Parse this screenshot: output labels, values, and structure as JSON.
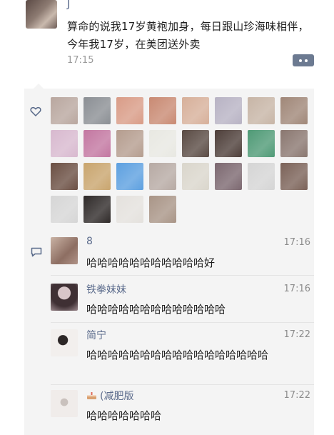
{
  "post": {
    "poster_name": "J",
    "text": "算命的说我17岁黄袍加身，每日跟山珍海味相伴，今年我17岁，在美团送外卖",
    "time": "17:15"
  },
  "likes": {
    "avatars": [
      {
        "color": "#b9a79f"
      },
      {
        "color": "#8b8f94"
      },
      {
        "color": "#d99c87"
      },
      {
        "color": "#c98a73"
      },
      {
        "color": "#d7b09a"
      },
      {
        "color": "#b8b3c4"
      },
      {
        "color": "#c7b5a6"
      },
      {
        "color": "#a08778"
      },
      {
        "color": "#d8b9cf"
      },
      {
        "color": "#c377a1"
      },
      {
        "color": "#b59d8f"
      },
      {
        "color": "#e8e8e2"
      },
      {
        "color": "#5a4b44"
      },
      {
        "color": "#4e3f3a"
      },
      {
        "color": "#4f9a76"
      },
      {
        "color": "#8a7770"
      },
      {
        "color": "#6b4f43"
      },
      {
        "color": "#c9a56e"
      },
      {
        "color": "#5da0e0"
      },
      {
        "color": "#b7aaa4"
      },
      {
        "color": "#dad6cc"
      },
      {
        "color": "#7c6870"
      },
      {
        "color": "#d5d5d5"
      },
      {
        "color": "#7b6258"
      },
      {
        "color": "#d6d6d6"
      },
      {
        "color": "#2f2a29"
      },
      {
        "color": "#e4e1dd"
      },
      {
        "color": "#a99587"
      }
    ]
  },
  "comments": [
    {
      "name": "8",
      "time": "17:16",
      "text": "哈哈哈哈哈哈哈哈哈哈哈好",
      "avatar_color": "#a58a7d"
    },
    {
      "name": "铁拳妹妹",
      "time": "17:16",
      "text": "哈哈哈哈哈哈哈哈哈哈哈哈哈",
      "avatar_color": "#6d5a63"
    },
    {
      "name": "简宁",
      "time": "17:22",
      "text": "哈哈哈哈哈哈哈哈哈哈哈哈哈哈哈哈哈",
      "avatar_color": "#e9e6e4"
    },
    {
      "name": "(减肥版",
      "time": "17:22",
      "text": "哈哈哈哈哈哈哈",
      "avatar_color": "#e6e2e0"
    }
  ],
  "colors": {
    "link_name": "#5b6b8c",
    "panel_bg": "#f4f4f4",
    "more_button": "#6c7a91"
  }
}
